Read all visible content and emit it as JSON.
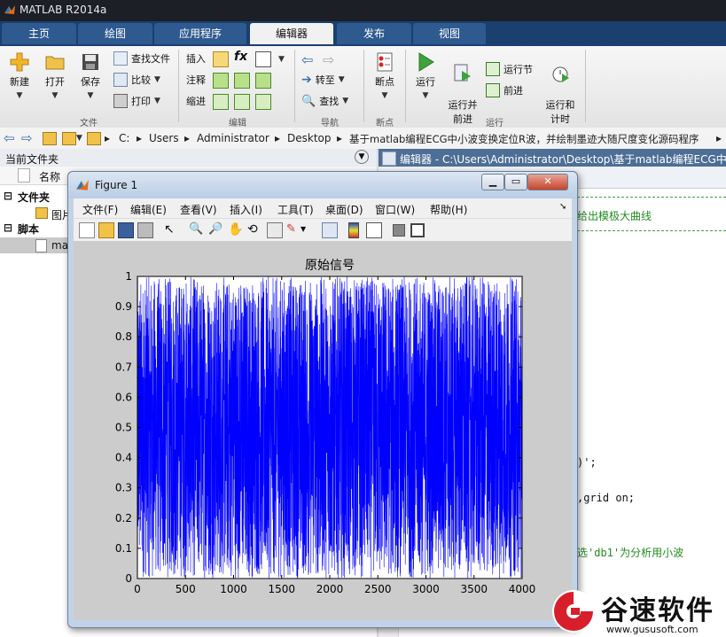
{
  "window": {
    "title": "MATLAB R2014a"
  },
  "tabs": [
    {
      "label": "主页"
    },
    {
      "label": "绘图"
    },
    {
      "label": "应用程序"
    },
    {
      "label": "编辑器"
    },
    {
      "label": "发布"
    },
    {
      "label": "视图"
    }
  ],
  "ribbon": {
    "file": {
      "new": "新建",
      "open": "打开",
      "save": "保存",
      "find_files": "查找文件",
      "compare": "比较",
      "print": "打印",
      "group": "文件"
    },
    "edit": {
      "insert": "插入",
      "comment": "注释",
      "indent": "缩进",
      "fx": "fx",
      "group": "编辑"
    },
    "navigate": {
      "goto": "转至",
      "find": "查找",
      "group": "导航"
    },
    "breakpoints": {
      "breakpoints": "断点",
      "group": "断点"
    },
    "run": {
      "run": "运行",
      "run_advance": "运行并\n前进",
      "run_section": "运行节",
      "advance": "前进",
      "run_time": "运行和\n计时",
      "group": "运行"
    }
  },
  "address": {
    "parts": [
      "C:",
      "Users",
      "Administrator",
      "Desktop",
      "基于matlab编程ECG中小波变换定位R波，并绘制墨迹大随尺度变化源码程序"
    ]
  },
  "current_folder": {
    "title": "当前文件夹",
    "col_name": "名称",
    "folders_label": "文件夹",
    "folder_item": "图片",
    "scripts_label": "脚本",
    "script_item": "ma"
  },
  "editor": {
    "title": "编辑器 - C:\\Users\\Administrator\\Desktop\\基于matlab编程ECG中小",
    "lines": [
      "给出模极大曲线",
      ")';",
      ",grid on;",
      "选'db1'为分析用小波"
    ]
  },
  "figure": {
    "title": "Figure 1",
    "menu": [
      "文件(F)",
      "编辑(E)",
      "查看(V)",
      "插入(I)",
      "工具(T)",
      "桌面(D)",
      "窗口(W)",
      "帮助(H)"
    ]
  },
  "chart_data": {
    "type": "line",
    "title": "原始信号",
    "xlabel": "",
    "ylabel": "",
    "xlim": [
      0,
      4000
    ],
    "ylim": [
      0,
      1
    ],
    "xticks": [
      0,
      500,
      1000,
      1500,
      2000,
      2500,
      3000,
      3500,
      4000
    ],
    "yticks": [
      0,
      0.1,
      0.2,
      0.3,
      0.4,
      0.5,
      0.6,
      0.7,
      0.8,
      0.9,
      1
    ],
    "series": [
      {
        "color": "#0000ff",
        "description_values": {
          "n_points": 4000,
          "min": 0,
          "max": 1,
          "distribution": "uniform random noise"
        }
      }
    ],
    "grid": false
  },
  "watermark": {
    "brand": "谷速软件",
    "url": "www.gususoft.com"
  },
  "colors": {
    "accent": "#1b3f6e",
    "series": "#0000ff",
    "figure_bg": "#cccccc"
  }
}
